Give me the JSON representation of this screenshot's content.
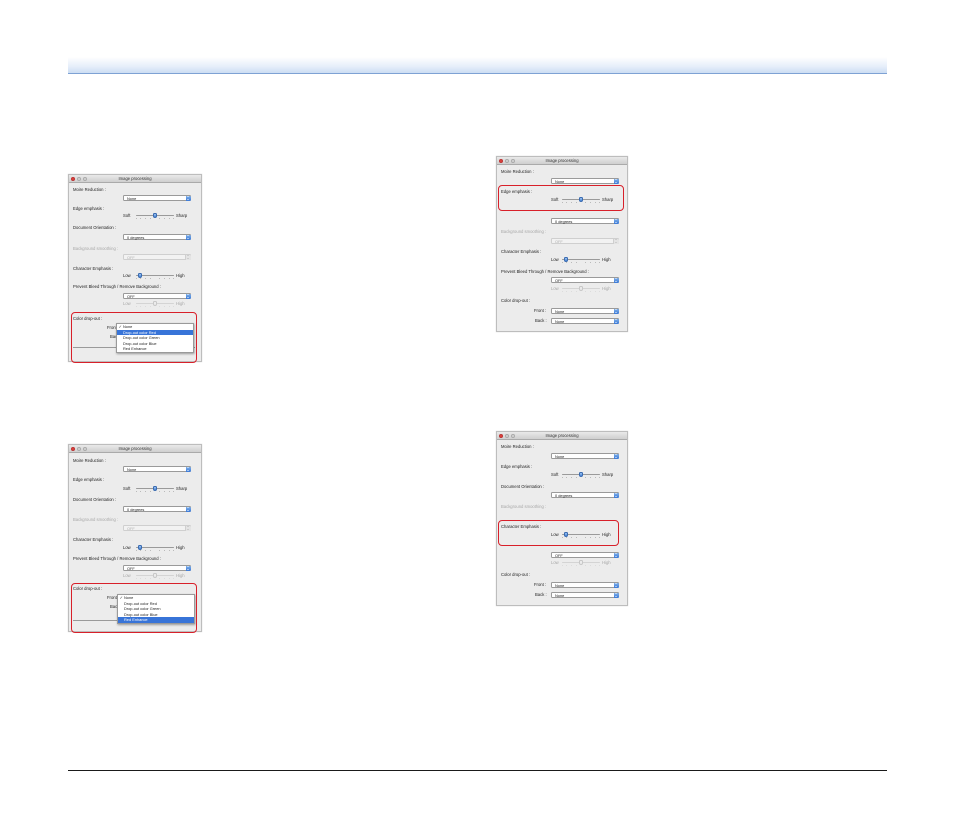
{
  "window": {
    "title": "Image processing",
    "labels": {
      "moire": "Moire Reduction :",
      "edge": "Edge emphasis :",
      "orientation": "Document Orientation :",
      "bg_smoothing": "Background smoothing :",
      "char_emphasis": "Character Emphasis :",
      "bleed": "Prevent Bleed Through / Remove Background :",
      "color_dropout": "Color drop-out :",
      "front": "Front :",
      "back": "Back :",
      "front_short": "Front",
      "back_short": "Back"
    },
    "values": {
      "moire": "None",
      "orientation": "0 degrees",
      "bg_smoothing": "OFF",
      "bleed": "OFF",
      "front": "None",
      "back": "None"
    },
    "slider_labels": {
      "soft": "Soft",
      "sharp": "Sharp",
      "low": "Low",
      "high": "High"
    },
    "edge_level": 0.5,
    "char_level": 0.1,
    "bleed_level": 0.5
  },
  "dropout_menu": {
    "options": [
      "None",
      "Drop-out color Red",
      "Drop-out color Green",
      "Drop-out color Blue",
      "Red Enhance"
    ],
    "checked": "None",
    "highlighted_first_screenshot": "Drop-out color Red",
    "highlighted_second_screenshot": "Red Enhance"
  },
  "colors": {
    "highlight_box": "#d8202a",
    "menu_highlight": "#3874d8",
    "header_rule": "#7ea2d4"
  }
}
